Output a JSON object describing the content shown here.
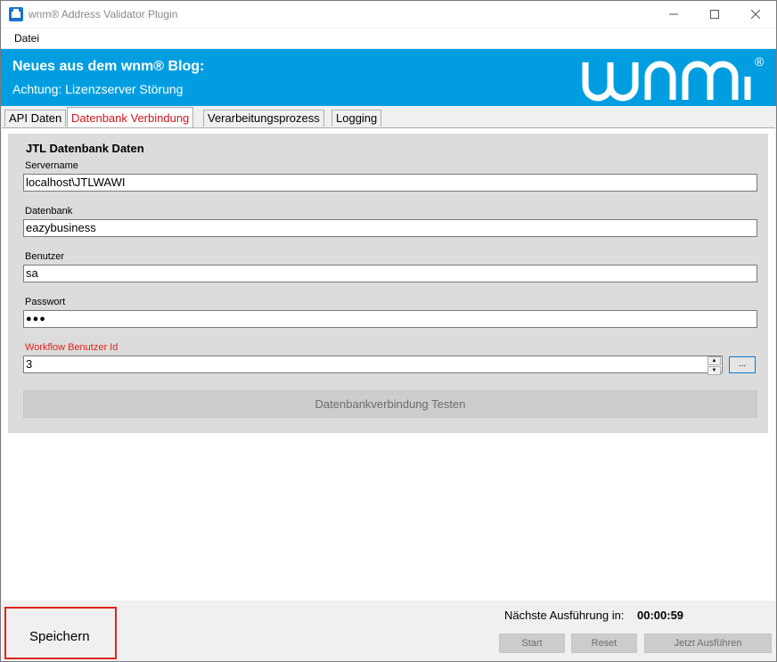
{
  "window": {
    "title": "wnm® Address Validator Plugin"
  },
  "menu": {
    "file": "Datei"
  },
  "banner": {
    "title": "Neues aus dem wnm® Blog:",
    "subtitle": "Achtung: Lizenzserver Störung",
    "logo_text": "wnm",
    "logo_mark": "®"
  },
  "tabs": [
    {
      "label": "API Daten"
    },
    {
      "label": "Datenbank Verbindung"
    },
    {
      "label": "Verarbeitungsprozess"
    },
    {
      "label": "Logging"
    }
  ],
  "form": {
    "group_title": "JTL Datenbank Daten",
    "servername_label": "Servername",
    "servername_value": "localhost\\JTLWAWI",
    "database_label": "Datenbank",
    "database_value": "eazybusiness",
    "user_label": "Benutzer",
    "user_value": "sa",
    "password_label": "Passwort",
    "password_value": "●●●",
    "workflow_label": "Workflow Benutzer Id",
    "workflow_value": "3",
    "browse_label": "...",
    "test_button": "Datenbankverbindung Testen"
  },
  "footer": {
    "save": "Speichern",
    "next_run_label": "Nächste Ausführung in:",
    "next_run_time": "00:00:59",
    "start": "Start",
    "reset": "Reset",
    "run_now": "Jetzt Ausführen"
  },
  "colors": {
    "banner": "#009ee0",
    "active_tab": "#d2161b",
    "highlight": "#e0241c"
  }
}
